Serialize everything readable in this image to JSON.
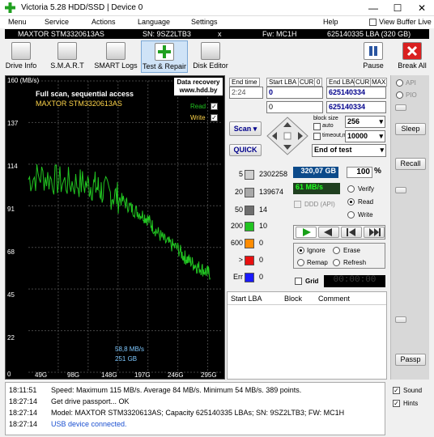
{
  "window": {
    "title": "Victoria 5.28 HDD/SSD | Device 0",
    "min": "—",
    "max": "☐",
    "close": "✕"
  },
  "menu": {
    "items": [
      "Menu",
      "Service",
      "Actions",
      "Language",
      "Settings",
      "Help"
    ],
    "view_buffer": "View Buffer Live"
  },
  "device": {
    "model": "MAXTOR STM3320613AS",
    "sn": "SN: 9SZ2LTB3",
    "x": "x",
    "fw": "Fw: MC1H",
    "lba": "625140335 LBA (320 GB)"
  },
  "toolbar": {
    "drive_info": "Drive Info",
    "smart": "S.M.A.R.T",
    "smart_logs": "SMART Logs",
    "test_repair": "Test & Repair",
    "disk_editor": "Disk Editor",
    "pause": "Pause",
    "break_all": "Break All"
  },
  "graph": {
    "ymax": "160 (MB/s)",
    "y137": "137",
    "y114": "114",
    "y91": "91",
    "y68": "68",
    "y45": "45",
    "y22": "22",
    "y0": "0",
    "x_ticks": [
      "49G",
      "98G",
      "148G",
      "197G",
      "246G",
      "295G"
    ],
    "title1": "Full scan, sequential access",
    "title2": "MAXTOR STM3320613AS",
    "promo1": "Data recovery",
    "promo2": "www.hdd.by",
    "read": "Read",
    "write": "Write",
    "speed_now": "58,8 MB/s",
    "pos_now": "251 GB"
  },
  "chart_data": {
    "type": "line",
    "xlabel": "",
    "ylabel": "MB/s",
    "ylim": [
      0,
      160
    ],
    "xlim": [
      0,
      320
    ],
    "series": [
      {
        "name": "Read",
        "values": [
          [
            0,
            106
          ],
          [
            20,
            108
          ],
          [
            40,
            106
          ],
          [
            60,
            104
          ],
          [
            80,
            104
          ],
          [
            98,
            103
          ],
          [
            110,
            102
          ],
          [
            120,
            100
          ],
          [
            135,
            98
          ],
          [
            148,
            96
          ],
          [
            160,
            93
          ],
          [
            170,
            90
          ],
          [
            180,
            88
          ],
          [
            190,
            86
          ],
          [
            197,
            84
          ],
          [
            205,
            80
          ],
          [
            215,
            76
          ],
          [
            225,
            72
          ],
          [
            235,
            70
          ],
          [
            246,
            68
          ],
          [
            255,
            64
          ],
          [
            262,
            62
          ],
          [
            270,
            60
          ],
          [
            278,
            58
          ],
          [
            285,
            57
          ],
          [
            293,
            55
          ],
          [
            300,
            54
          ]
        ]
      }
    ]
  },
  "controls": {
    "end_time_label": "End time",
    "end_time": "2:24",
    "start_lba_label": "Start LBA",
    "cur1": "CUR",
    "zero1": "0",
    "end_lba_label": "End LBA",
    "cur2": "CUR",
    "max": "MAX",
    "start_lba": "0",
    "end_lba": "625140334",
    "start_lba2": "0",
    "end_lba2": "625140334",
    "block_size_label": "block size",
    "auto": "auto",
    "block_size": "256",
    "timeout_label": "timeout,ms",
    "timeout": "10000",
    "scan": "Scan",
    "quick": "QUICK",
    "end_mode": "End of test"
  },
  "blocks": [
    {
      "label": "5",
      "value": "2302258",
      "color": "#cfcfcf"
    },
    {
      "label": "20",
      "value": "139674",
      "color": "#a8a8a8"
    },
    {
      "label": "50",
      "value": "14",
      "color": "#6e6e6e"
    },
    {
      "label": "200",
      "value": "10",
      "color": "#21c421"
    },
    {
      "label": "600",
      "value": "0",
      "color": "#ff8c00"
    },
    {
      "label": ">",
      "value": "0",
      "color": "#e81010"
    },
    {
      "label": "Err",
      "value": "0",
      "color": "#1a1aff"
    }
  ],
  "status": {
    "size": "320,07 GB",
    "percent": "100",
    "pct_sign": "%",
    "speed": "61 MB/s",
    "ddd": "DDD (API)",
    "verify": "Verify",
    "read": "Read",
    "write": "Write",
    "ignore": "Ignore",
    "erase": "Erase",
    "remap": "Remap",
    "refresh": "Refresh",
    "grid": "Grid",
    "timer": "00:00:00"
  },
  "table": {
    "headers": [
      "Start LBA",
      "Block",
      "Comment"
    ]
  },
  "rightpanel": {
    "api": "API",
    "pio": "PIO",
    "sleep": "Sleep",
    "recall": "Recall",
    "passp": "Passp"
  },
  "log": [
    {
      "ts": "18:11:51",
      "msg": "Speed: Maximum 115 MB/s. Average 84 MB/s. Minimum 54 MB/s. 389 points."
    },
    {
      "ts": "18:27:14",
      "msg": "Get drive passport... OK"
    },
    {
      "ts": "18:27:14",
      "msg": "Model: MAXTOR STM3320613AS; Capacity 625140335 LBAs; SN: 9SZ2LTB3; FW: MC1H"
    },
    {
      "ts": "18:27:14",
      "msg": "USB device connected."
    }
  ],
  "options": {
    "sound": "Sound",
    "hints": "Hints"
  },
  "colors": {
    "graph_line": "#21c421",
    "graph_bg": "#000000",
    "size_bg": "#0c4a8a",
    "speed_bg": "#1f3f1f"
  }
}
